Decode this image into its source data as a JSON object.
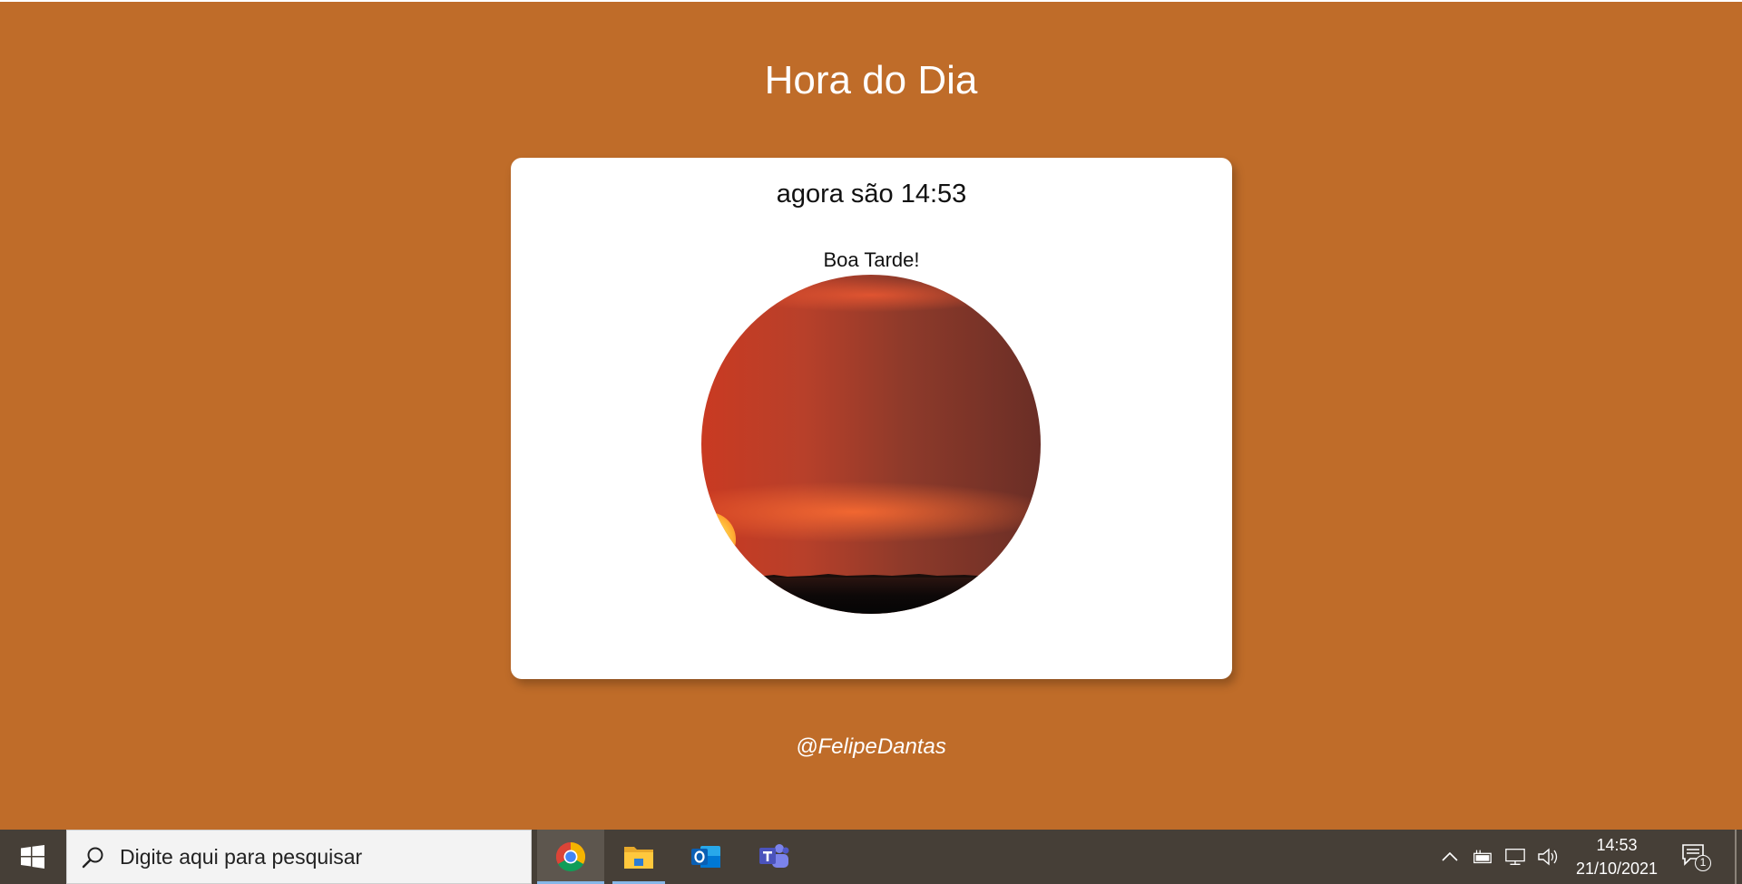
{
  "page": {
    "title": "Hora do Dia",
    "time_message": "agora são 14:53",
    "greeting": "Boa Tarde!",
    "image_alt": "Pôr do sol",
    "footer": "@FelipeDantas",
    "background_color": "#BF6C29"
  },
  "taskbar": {
    "search_placeholder": "Digite aqui para pesquisar",
    "apps": [
      {
        "name": "Google Chrome",
        "icon": "chrome-icon",
        "active": true
      },
      {
        "name": "Explorador de Arquivos",
        "icon": "folder-icon",
        "active": false
      },
      {
        "name": "Outlook",
        "icon": "outlook-icon",
        "active": false
      },
      {
        "name": "Microsoft Teams",
        "icon": "teams-icon",
        "active": false
      }
    ],
    "tray": {
      "icons": [
        "chevron-up-icon",
        "battery-icon",
        "network-icon",
        "volume-icon"
      ],
      "time": "14:53",
      "date": "21/10/2021",
      "notification_count": "1"
    },
    "background_color": "#463f37"
  }
}
